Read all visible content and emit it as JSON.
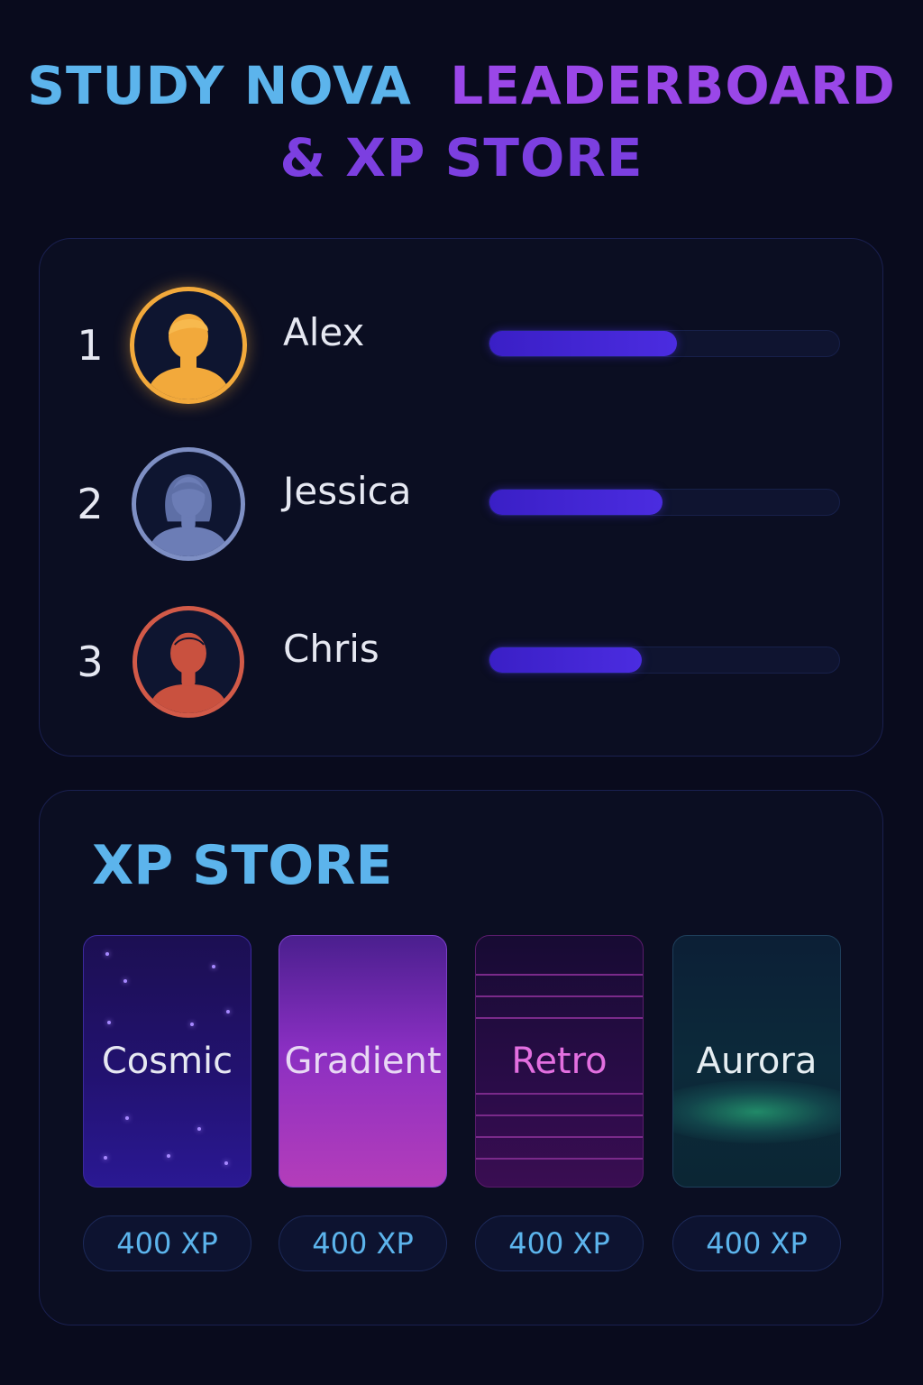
{
  "header": {
    "line1_part1": "STUDY NOVA",
    "line1_part2": "LEADERBOARD",
    "line2": "& XP STORE"
  },
  "leaderboard": {
    "entries": [
      {
        "rank": "1",
        "name": "Alex",
        "progress": 0.535,
        "avatar_color": "#f2a93b",
        "avatar_icon": "user-avatar-icon"
      },
      {
        "rank": "2",
        "name": "Jessica",
        "progress": 0.495,
        "avatar_color": "#7e8fc4",
        "avatar_icon": "user-avatar-icon"
      },
      {
        "rank": "3",
        "name": "Chris",
        "progress": 0.435,
        "avatar_color": "#d25a48",
        "avatar_icon": "user-avatar-icon"
      }
    ]
  },
  "store": {
    "title": "XP STORE",
    "items": [
      {
        "name": "Cosmic",
        "price": "400 XP"
      },
      {
        "name": "Gradient",
        "price": "400 XP"
      },
      {
        "name": "Retro",
        "price": "400 XP"
      },
      {
        "name": "Aurora",
        "price": "400 XP"
      }
    ]
  },
  "colors": {
    "background": "#090b1d",
    "accent_blue": "#5cb4ec",
    "accent_purple": "#9a47e8",
    "progress_fill": "#4b2ce0"
  }
}
